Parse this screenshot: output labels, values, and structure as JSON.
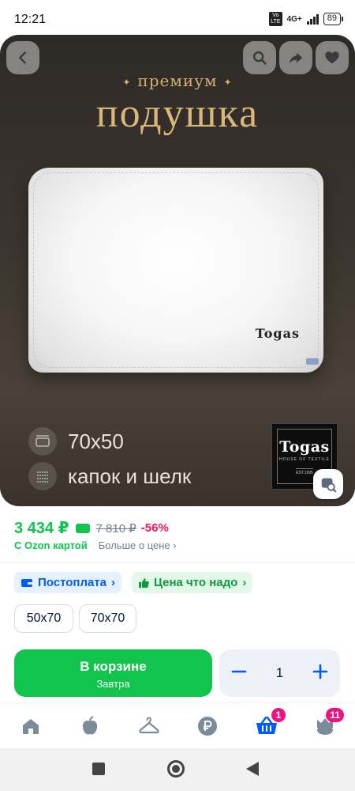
{
  "status_bar": {
    "time": "12:21",
    "volte": "VoLTE",
    "network": "4G+",
    "battery": "89"
  },
  "hero": {
    "premium_label": "премиум",
    "title": "подушка",
    "pillow_brand": "Togas",
    "features": [
      {
        "icon": "size-icon",
        "text": "70х50"
      },
      {
        "icon": "fabric-icon",
        "text": "капок и шелк"
      }
    ],
    "logo": {
      "name": "Togas",
      "sub": "HOUSE OF TEXTILE",
      "est": "EST.1995"
    }
  },
  "price": {
    "current": "3 434 ₽",
    "old": "7 810 ₽",
    "discount": "-56%",
    "ozon_card": "С Ozon картой",
    "more_link": "Больше о цене"
  },
  "badges": [
    {
      "label": "Постоплата",
      "color": "#005bff"
    },
    {
      "label": "Цена что надо",
      "color": "#0d9b3d"
    }
  ],
  "sizes": [
    "50х70",
    "70х70"
  ],
  "cart": {
    "button_label": "В корзине",
    "delivery": "Завтра",
    "quantity": "1"
  },
  "bottom_nav": {
    "cart_badge": "1",
    "profile_badge": "11"
  },
  "colors": {
    "accent_green": "#10c44c",
    "discount_pink": "#f91155",
    "badge_pink": "#f1117e",
    "brand_blue": "#005bff"
  }
}
